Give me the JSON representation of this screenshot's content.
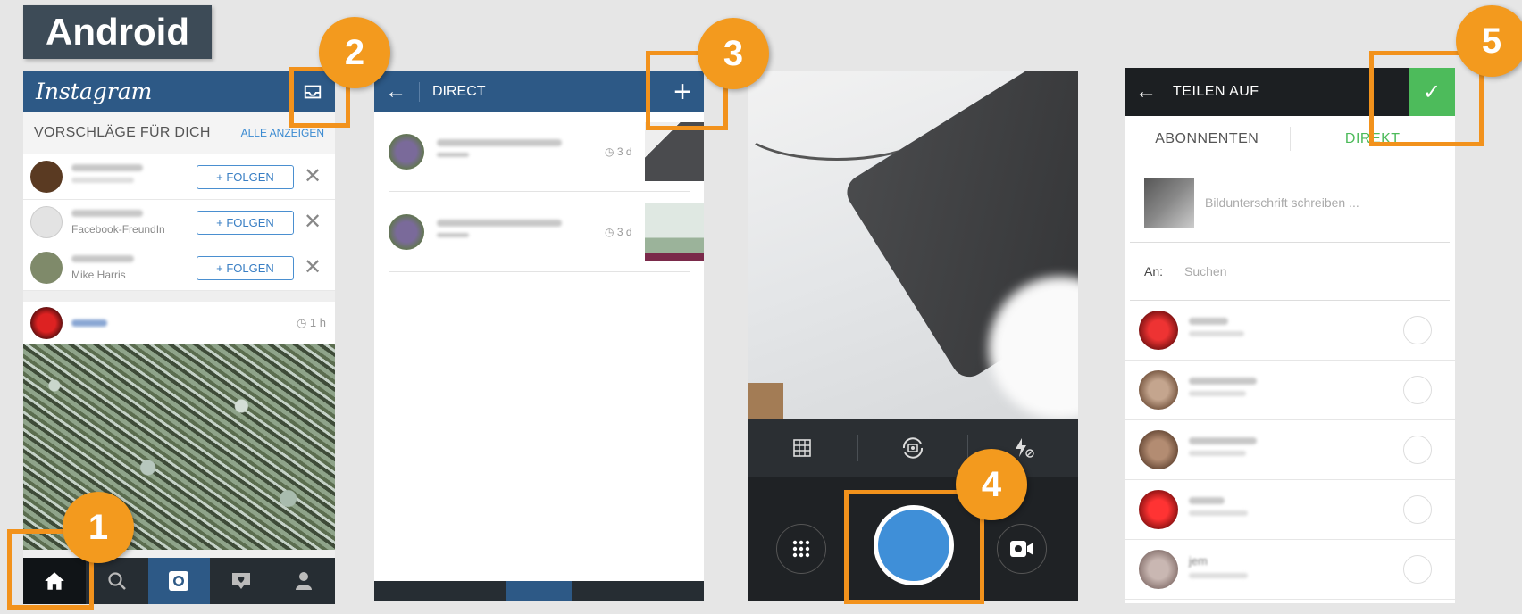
{
  "platform_label": "Android",
  "screen1": {
    "logo": "Instagram",
    "suggestions_title": "VORSCHLÄGE FÜR DICH",
    "suggestions_all": "ALLE ANZEIGEN",
    "rows": [
      {
        "subtitle": "",
        "button": "+ FOLGEN",
        "avatar_color": "#5a3a22"
      },
      {
        "subtitle": "Facebook-FreundIn",
        "button": "+ FOLGEN",
        "avatar_color": "#e8e8e8"
      },
      {
        "subtitle": "Mike Harris",
        "button": "+ FOLGEN",
        "avatar_color": "#7f8a6a"
      }
    ],
    "post_time": "1 h"
  },
  "screen2": {
    "title": "DIRECT",
    "rows": [
      {
        "time": "3 d",
        "thumb": "#4a4b4e"
      },
      {
        "time": "3 d",
        "thumb": "#9bb39a"
      }
    ]
  },
  "screen4": {
    "title": "TEILEN AUF",
    "tab_followers": "ABONNENTEN",
    "tab_direct": "DIREKT",
    "caption_placeholder": "Bildunterschrift schreiben ...",
    "to_label": "An:",
    "search_placeholder": "Suchen",
    "contacts": [
      {
        "name": "",
        "color": "#b51f1f"
      },
      {
        "name": "",
        "color": "#9a7a63"
      },
      {
        "name": "",
        "color": "#8c6a55"
      },
      {
        "name": "",
        "color": "#c22424"
      },
      {
        "name": "jem",
        "color": "#a38e88"
      }
    ]
  },
  "badges": [
    "1",
    "2",
    "3",
    "4",
    "5"
  ],
  "colors": {
    "accent": "#f2921c",
    "ig_blue": "#2d5986",
    "direct_green": "#4dbb5b",
    "shutter": "#3f8fd8"
  }
}
